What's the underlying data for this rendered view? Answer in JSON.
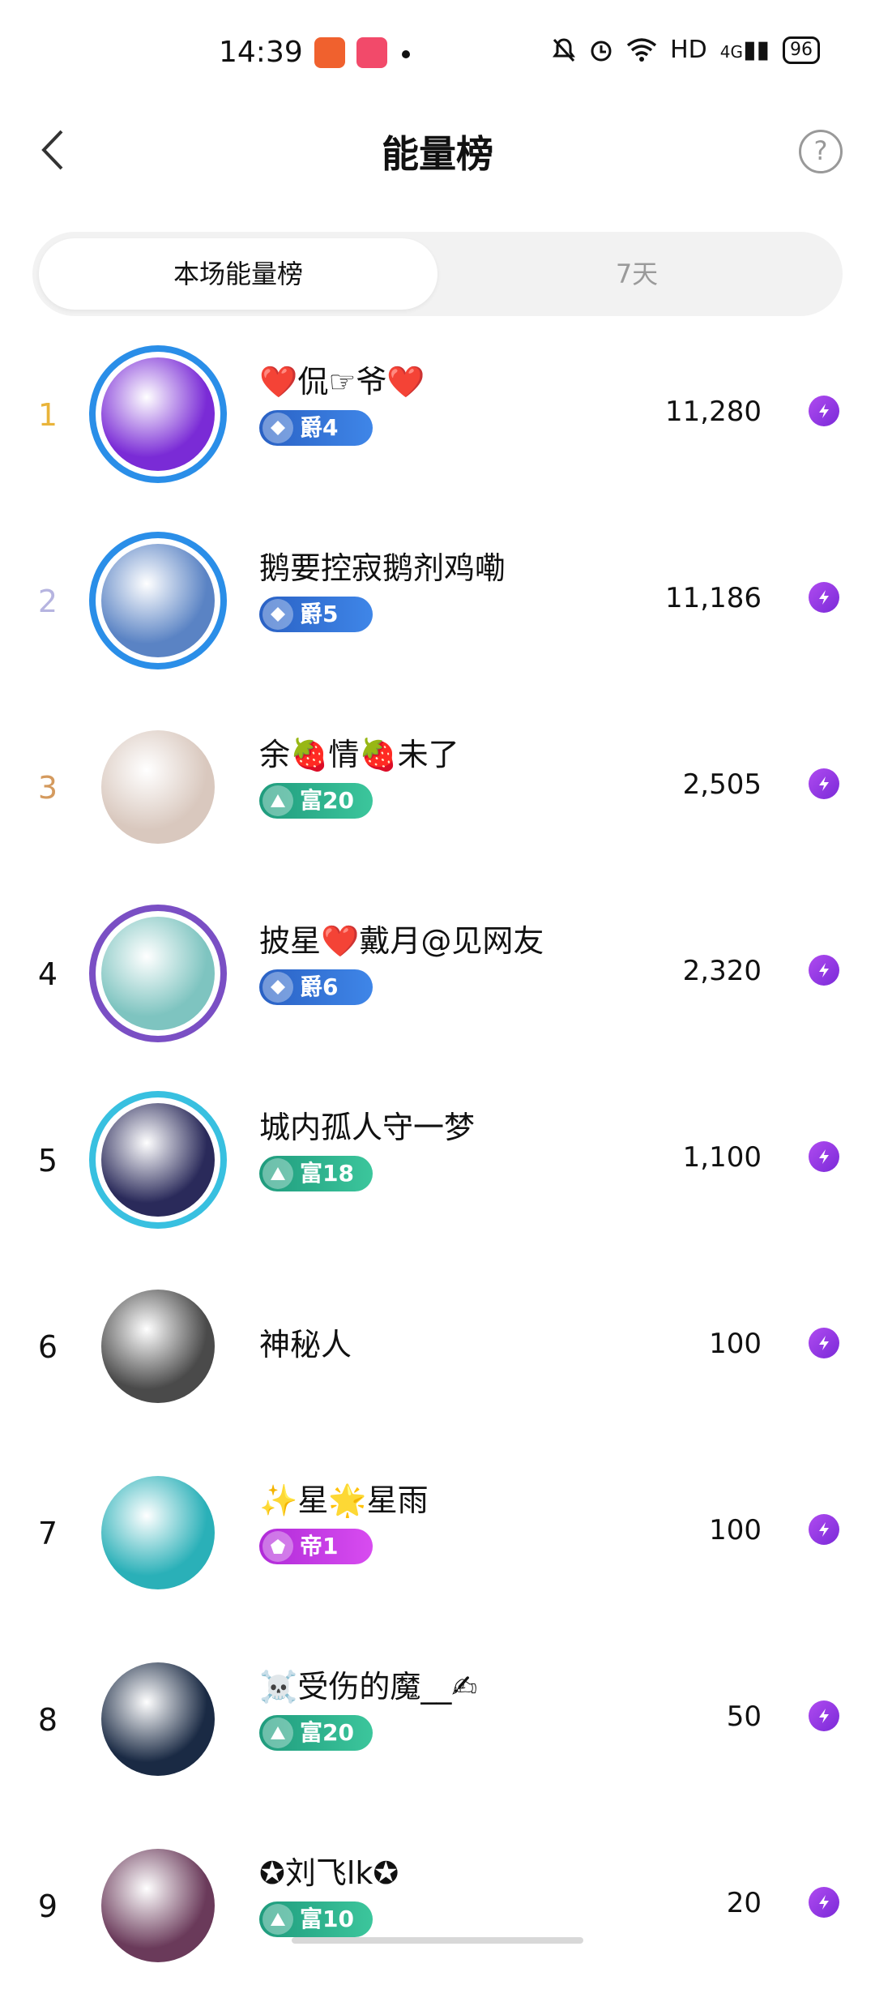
{
  "status_bar": {
    "time": "14:39",
    "network": "HD",
    "signal": "4G",
    "battery": "96"
  },
  "header": {
    "title": "能量榜",
    "back_icon": "chevron-left-icon",
    "help_icon": "question-circle-icon"
  },
  "tabs": [
    {
      "label": "本场能量榜",
      "active": true
    },
    {
      "label": "7天",
      "active": false
    }
  ],
  "colors": {
    "rank1": "#e9b43a",
    "rank2": "#b6b4e0",
    "rank3": "#d49a5e",
    "energy": "#8a2fe0"
  },
  "rows": [
    {
      "rank": "1",
      "name": "❤️侃☞爷❤️",
      "badge": "爵4",
      "badge_type": "jue",
      "score": "11,280",
      "avatar_color": "#7a2bd6"
    },
    {
      "rank": "2",
      "name": "鹅要控寂鹅剂鸡嘞",
      "badge": "爵5",
      "badge_type": "jue",
      "score": "11,186",
      "avatar_color": "#5a83c4"
    },
    {
      "rank": "3",
      "name": "余🍓情🍓未了",
      "badge": "富20",
      "badge_type": "fu",
      "score": "2,505",
      "avatar_color": "#d9c8be"
    },
    {
      "rank": "4",
      "name": "披星❤️戴月@见网友",
      "badge": "爵6",
      "badge_type": "jue",
      "score": "2,320",
      "avatar_color": "#7ec4c0"
    },
    {
      "rank": "5",
      "name": "城内孤人守一梦",
      "badge": "富18",
      "badge_type": "fu",
      "score": "1,100",
      "avatar_color": "#2a2a5a"
    },
    {
      "rank": "6",
      "name": "神秘人",
      "badge": "",
      "badge_type": "none",
      "score": "100",
      "avatar_color": "#4a4a4a"
    },
    {
      "rank": "7",
      "name": "✨星🌟星雨",
      "badge": "帝1",
      "badge_type": "di",
      "score": "100",
      "avatar_color": "#2ab0b8"
    },
    {
      "rank": "8",
      "name": "☠️受伤的魔__✍",
      "badge": "富20",
      "badge_type": "fu",
      "score": "50",
      "avatar_color": "#1a2a44"
    },
    {
      "rank": "9",
      "name": "✪刘飞lk✪",
      "badge": "富10",
      "badge_type": "fu",
      "score": "20",
      "avatar_color": "#6a3a5a"
    }
  ]
}
